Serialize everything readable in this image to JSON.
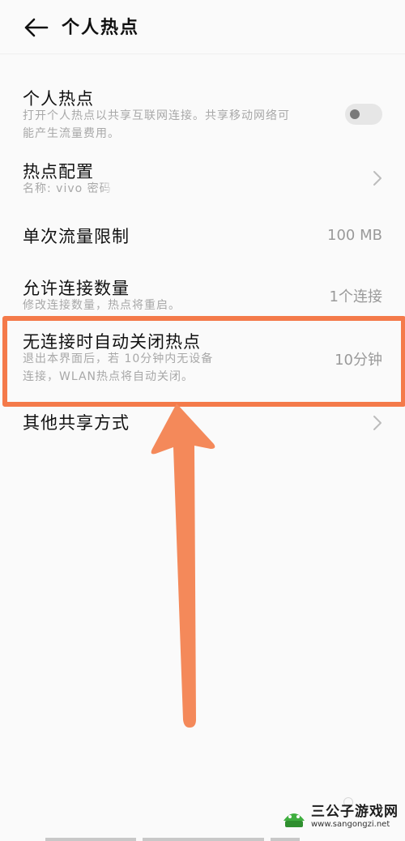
{
  "header": {
    "title": "个人热点"
  },
  "hotspot_toggle": {
    "title": "个人热点",
    "subtitle_line1": "打开个人热点以共享互联网连接。共享移动网络可",
    "subtitle_line2": "能产生流量费用。",
    "enabled": false
  },
  "hotspot_config": {
    "title": "热点配置",
    "subtitle": "名称: vivo  密码"
  },
  "data_limit": {
    "title": "单次流量限制",
    "value": "100 MB"
  },
  "connection_limit": {
    "title": "允许连接数量",
    "subtitle": "修改连接数量，热点将重启。",
    "value": "1个连接"
  },
  "auto_off": {
    "title": "无连接时自动关闭热点",
    "subtitle_line1": "退出本界面后，若 10分钟内无设备",
    "subtitle_line2": "连接，WLAN热点将自动关闭。",
    "value": "10分钟"
  },
  "other_share": {
    "title": "其他共享方式"
  },
  "watermark": {
    "name": "三公子游戏网",
    "url": "www.sangongzi.net"
  },
  "colors": {
    "highlight": "#f47a4a",
    "arrow": "#f4895a",
    "accent_green": "#3fae3f"
  }
}
